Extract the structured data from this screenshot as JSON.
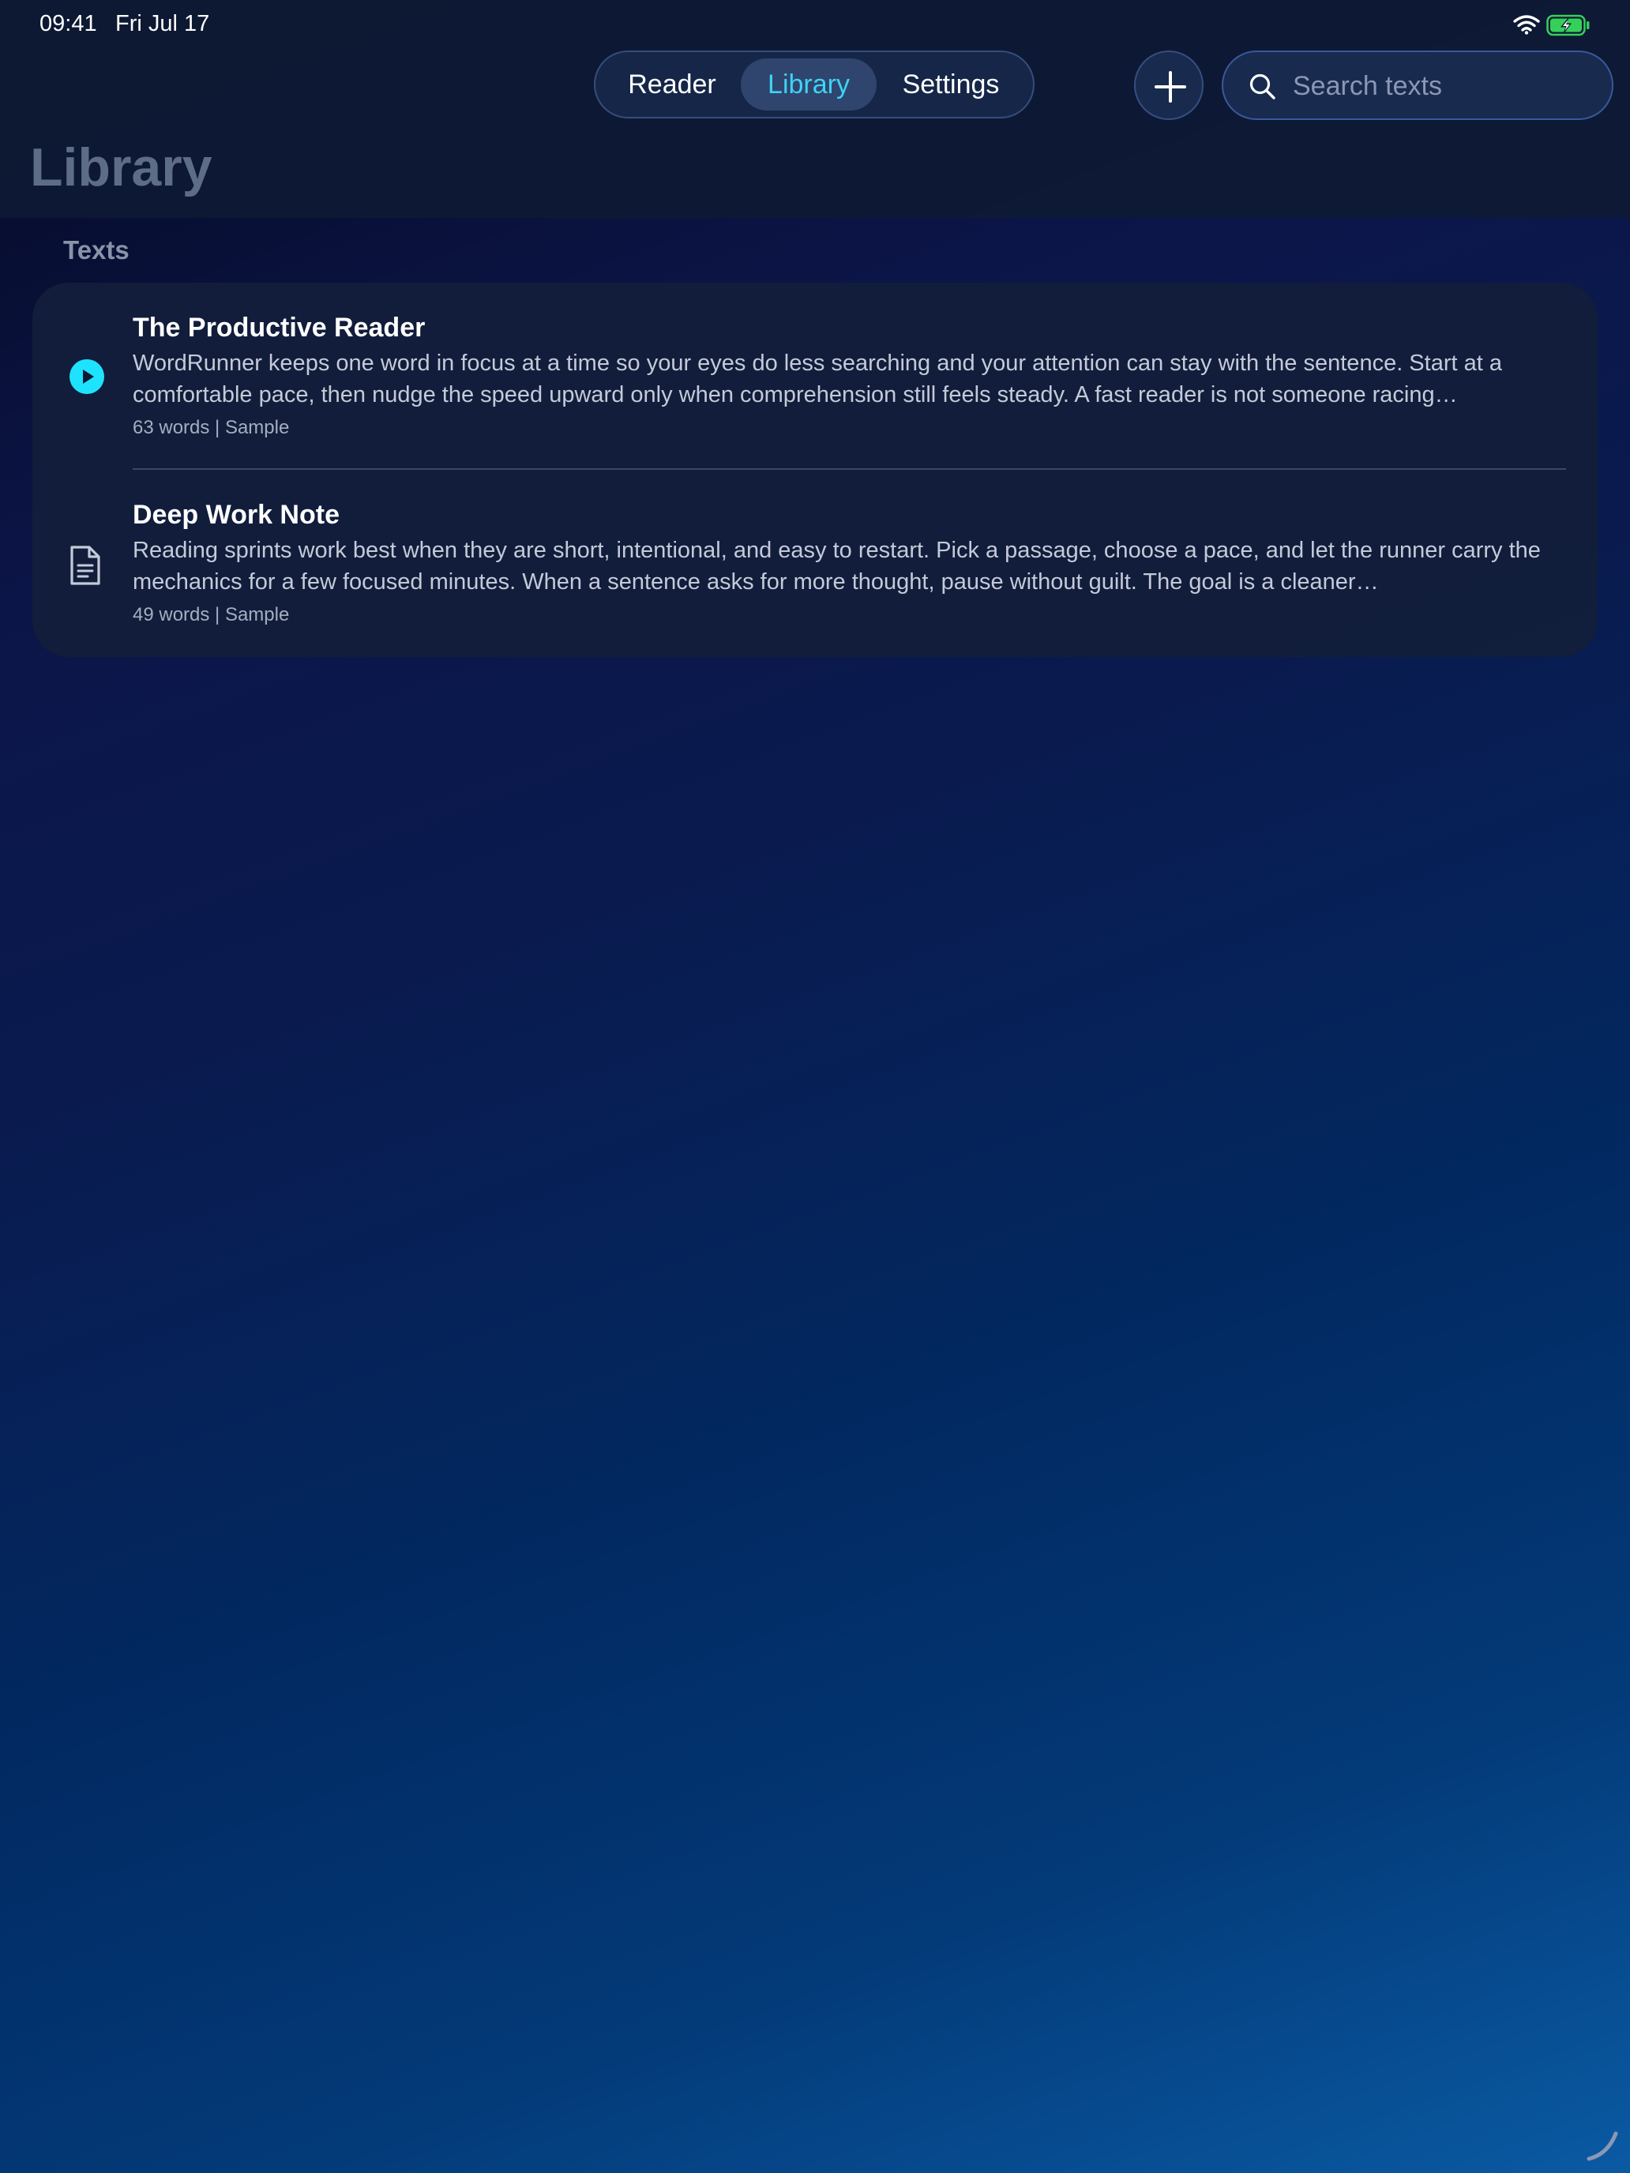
{
  "status_bar": {
    "time": "09:41",
    "date": "Fri Jul 17",
    "icons": [
      "wifi-icon",
      "battery-charging-icon"
    ]
  },
  "tabs": [
    {
      "label": "Reader",
      "selected": false
    },
    {
      "label": "Library",
      "selected": true
    },
    {
      "label": "Settings",
      "selected": false
    }
  ],
  "toolbar": {
    "add_icon": "plus-icon"
  },
  "search": {
    "placeholder": "Search texts",
    "value": "",
    "icon": "search-icon"
  },
  "page": {
    "title": "Library"
  },
  "section": {
    "header": "Texts"
  },
  "items": [
    {
      "icon": "play-circle-icon",
      "title": "The Productive Reader",
      "excerpt": "WordRunner keeps one word in focus at a time so your eyes do less searching and your attention can stay with the sentence. Start at a comfortable pace, then nudge the speed upward only when comprehension still feels steady. A fast reader is not someone racing…",
      "meta": "63 words | Sample"
    },
    {
      "icon": "document-icon",
      "title": "Deep Work Note",
      "excerpt": "Reading sprints work best when they are short, intentional, and easy to restart. Pick a passage, choose a pace, and let the runner carry the mechanics for a few focused minutes. When a sentence asks for more thought, pause without guilt. The goal is a cleaner…",
      "meta": "49 words | Sample"
    }
  ],
  "colors": {
    "accent": "#3fd2f5",
    "play_icon": "#1ee3ff",
    "battery": "#35d05a"
  }
}
